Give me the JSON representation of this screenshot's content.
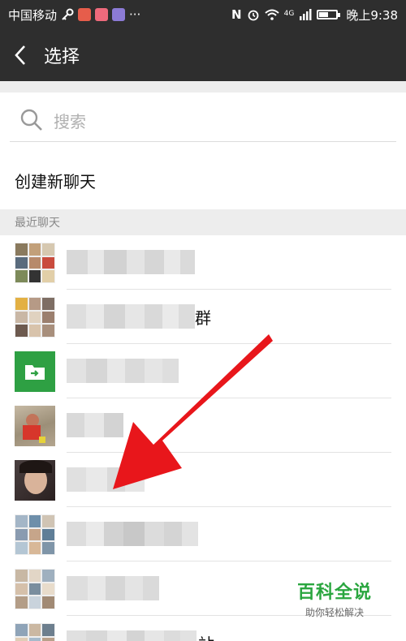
{
  "status_bar": {
    "carrier": "中国移动",
    "network": "4G",
    "time": "晚上9:38",
    "battery_level": 0.5,
    "icons": [
      "key-icon",
      "app-icon",
      "app-icon",
      "music-icon",
      "more-icon",
      "nfc-icon",
      "alarm-icon",
      "wifi-icon",
      "signal-icon",
      "battery-icon"
    ]
  },
  "header": {
    "title": "选择",
    "back_icon": "chevron-left-icon"
  },
  "search": {
    "placeholder": "搜索",
    "icon": "search-icon"
  },
  "new_chat": {
    "label": "创建新聊天"
  },
  "recent": {
    "section_label": "最近聊天"
  },
  "chats": [
    {
      "avatar": "group-photo-grid",
      "name_suffix": ""
    },
    {
      "avatar": "group-photo-grid",
      "name_suffix": "群"
    },
    {
      "avatar": "green-file-transfer-icon",
      "name_suffix": ""
    },
    {
      "avatar": "child-photo",
      "name_suffix": ""
    },
    {
      "avatar": "woman-photo",
      "name_suffix": ""
    },
    {
      "avatar": "group-photo-grid",
      "name_suffix": ""
    },
    {
      "avatar": "group-photo-grid",
      "name_suffix": ""
    },
    {
      "avatar": "group-photo-grid",
      "name_suffix": "站"
    }
  ],
  "watermark": {
    "title": "百科全说",
    "subtitle": "助你轻松解决"
  },
  "colors": {
    "bar": "#2e2e2e",
    "accent_green": "#2aa63f",
    "arrow_red": "#e8161b",
    "file_green": "#2ea043"
  }
}
